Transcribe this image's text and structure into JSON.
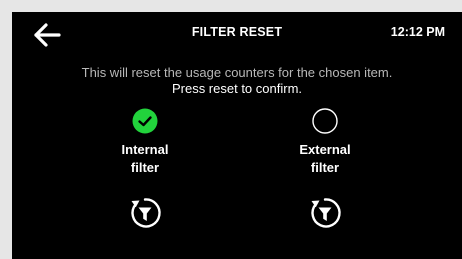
{
  "header": {
    "back_icon": "arrow-left-icon",
    "title": "FILTER RESET",
    "time": "12:12 PM"
  },
  "message": {
    "line1": "This will reset the usage counters for the chosen item.",
    "line2": "Press reset to confirm."
  },
  "options": [
    {
      "label_line1": "Internal",
      "label_line2": "filter",
      "selected": true,
      "icon": "filter-reset-icon"
    },
    {
      "label_line1": "External",
      "label_line2": "filter",
      "selected": false,
      "icon": "filter-reset-icon"
    }
  ],
  "colors": {
    "accent": "#22d33c",
    "background": "#000000",
    "frame": "#e6e6e6",
    "subtle_text": "#b8b8b8"
  }
}
